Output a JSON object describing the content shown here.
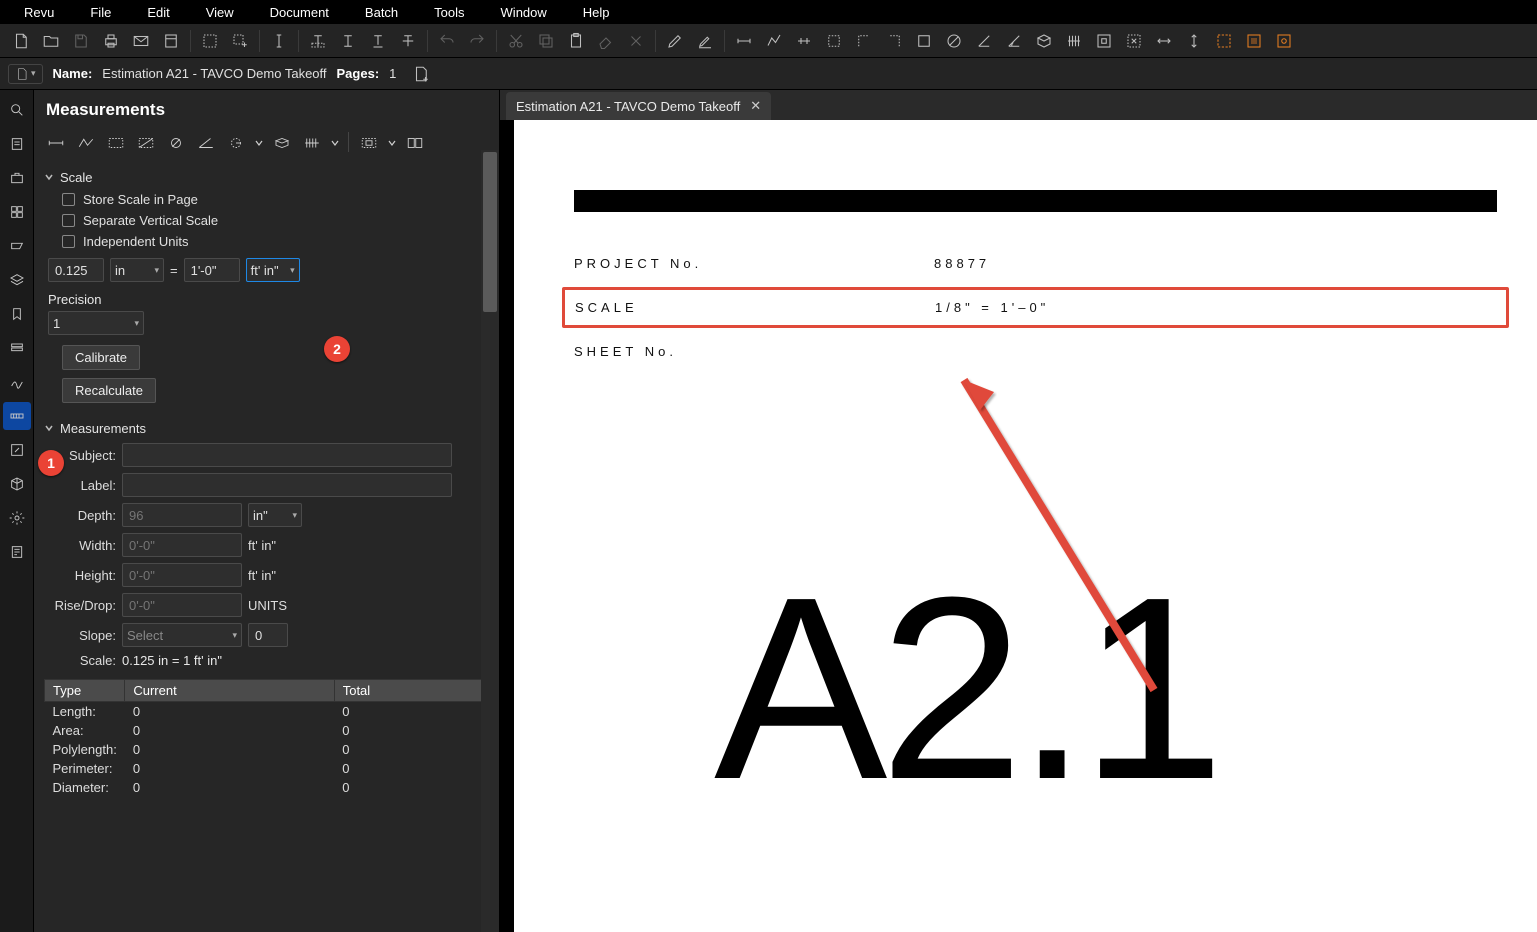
{
  "menu": {
    "items": [
      "Revu",
      "File",
      "Edit",
      "View",
      "Document",
      "Batch",
      "Tools",
      "Window",
      "Help"
    ]
  },
  "docbar": {
    "name_label": "Name:",
    "name_value": "Estimation A21 - TAVCO Demo Takeoff",
    "pages_label": "Pages:",
    "pages_value": "1"
  },
  "tab": {
    "title": "Estimation A21 - TAVCO Demo Takeoff"
  },
  "panel": {
    "title": "Measurements",
    "scale": {
      "heading": "Scale",
      "store": "Store Scale in Page",
      "separate": "Separate Vertical Scale",
      "independent": "Independent Units",
      "left_value": "0.125",
      "left_unit": "in",
      "equals": "=",
      "right_value": "1'-0\"",
      "right_unit": "ft' in\"",
      "precision_label": "Precision",
      "precision_value": "1",
      "calibrate": "Calibrate",
      "recalculate": "Recalculate"
    },
    "meas": {
      "heading": "Measurements",
      "subject": "Subject:",
      "label": "Label:",
      "depth": "Depth:",
      "depth_ph": "96",
      "depth_unit": "in\"",
      "width": "Width:",
      "width_ph": "0'-0\"",
      "width_unit": "ft' in\"",
      "height": "Height:",
      "height_ph": "0'-0\"",
      "height_unit": "ft' in\"",
      "rise": "Rise/Drop:",
      "rise_ph": "0'-0\"",
      "rise_unit": "UNITS",
      "slope": "Slope:",
      "slope_ph": "Select",
      "slope_val": "0",
      "scale_lbl": "Scale:",
      "scale_txt": "0.125 in = 1 ft' in\""
    },
    "table": {
      "headers": [
        "Type",
        "Current",
        "Total"
      ],
      "rows": [
        [
          "Length:",
          "0",
          "0"
        ],
        [
          "Area:",
          "0",
          "0"
        ],
        [
          "Polylength:",
          "0",
          "0"
        ],
        [
          "Perimeter:",
          "0",
          "0"
        ],
        [
          "Diameter:",
          "0",
          "0"
        ]
      ]
    }
  },
  "callouts": {
    "one": "1",
    "two": "2"
  },
  "drawing": {
    "project_k": "PROJECT  No.",
    "project_v": "88877",
    "scale_k": "SCALE",
    "scale_v": "1/8\"  =  1'–0\"",
    "sheet_k": "SHEET  No.",
    "sheet_big": "A2.1"
  }
}
